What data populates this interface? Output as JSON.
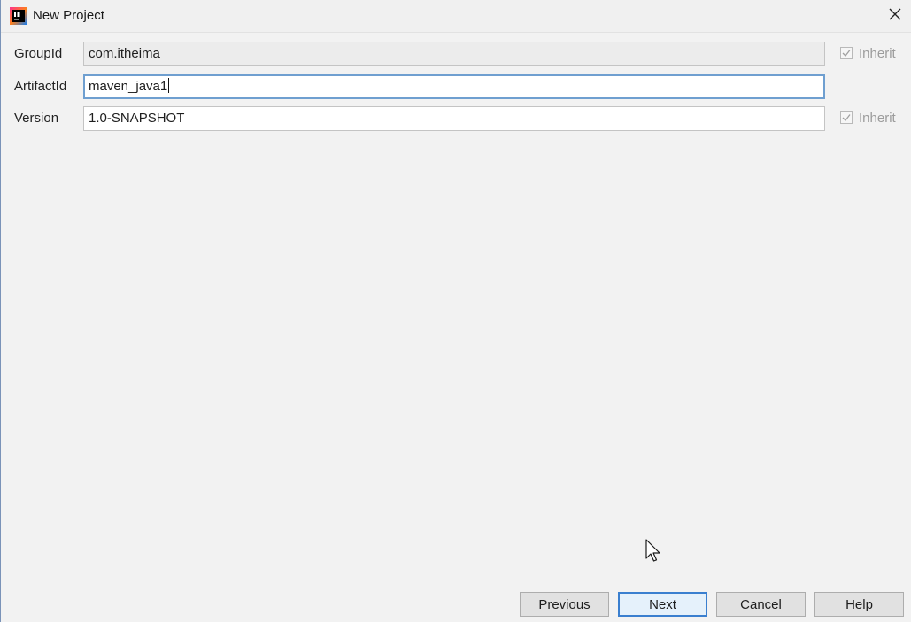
{
  "window": {
    "title": "New Project",
    "app_icon": "intellij-idea-icon",
    "close_icon": "close-icon"
  },
  "form": {
    "group_id": {
      "label": "GroupId",
      "value": "com.itheima",
      "inherit_label": "Inherit",
      "inherit_checked": true
    },
    "artifact_id": {
      "label": "ArtifactId",
      "value": "maven_java1"
    },
    "version": {
      "label": "Version",
      "value": "1.0-SNAPSHOT",
      "inherit_label": "Inherit",
      "inherit_checked": true
    }
  },
  "buttons": {
    "previous": "Previous",
    "next": "Next",
    "cancel": "Cancel",
    "help": "Help"
  },
  "colors": {
    "dialog_background": "#f2f2f2",
    "focus_border": "#6f9fd0",
    "default_button_border": "#3a7fcf"
  }
}
